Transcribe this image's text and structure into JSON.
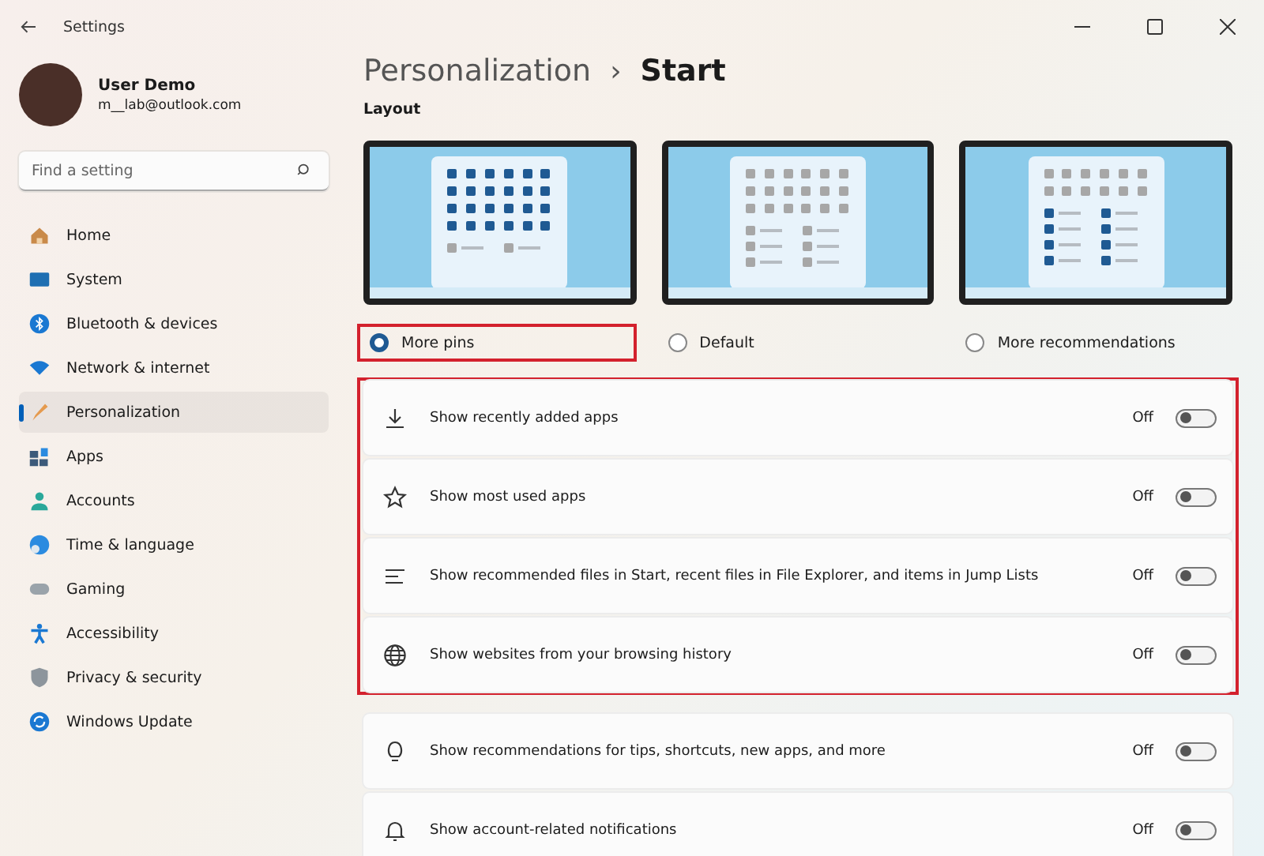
{
  "window": {
    "title": "Settings"
  },
  "account": {
    "name": "User Demo",
    "email": "m__lab@outlook.com"
  },
  "search": {
    "placeholder": "Find a setting"
  },
  "sidebar": {
    "items": [
      {
        "label": "Home",
        "selected": false
      },
      {
        "label": "System",
        "selected": false
      },
      {
        "label": "Bluetooth & devices",
        "selected": false
      },
      {
        "label": "Network & internet",
        "selected": false
      },
      {
        "label": "Personalization",
        "selected": true
      },
      {
        "label": "Apps",
        "selected": false
      },
      {
        "label": "Accounts",
        "selected": false
      },
      {
        "label": "Time & language",
        "selected": false
      },
      {
        "label": "Gaming",
        "selected": false
      },
      {
        "label": "Accessibility",
        "selected": false
      },
      {
        "label": "Privacy & security",
        "selected": false
      },
      {
        "label": "Windows Update",
        "selected": false
      }
    ]
  },
  "breadcrumb": {
    "parent": "Personalization",
    "separator": "›",
    "current": "Start"
  },
  "layout": {
    "heading": "Layout",
    "options": [
      {
        "label": "More pins",
        "kind": "pins",
        "selected": true,
        "highlighted": true
      },
      {
        "label": "Default",
        "kind": "default",
        "selected": false,
        "highlighted": false
      },
      {
        "label": "More recommendations",
        "kind": "recommendations",
        "selected": false,
        "highlighted": false
      }
    ]
  },
  "settings": [
    {
      "label": "Show recently added apps",
      "state": "Off",
      "on": false,
      "highlighted": true
    },
    {
      "label": "Show most used apps",
      "state": "Off",
      "on": false,
      "highlighted": true
    },
    {
      "label": "Show recommended files in Start, recent files in File Explorer, and items in Jump Lists",
      "state": "Off",
      "on": false,
      "highlighted": true
    },
    {
      "label": "Show websites from your browsing history",
      "state": "Off",
      "on": false,
      "highlighted": true
    },
    {
      "label": "Show recommendations for tips, shortcuts, new apps, and more",
      "state": "Off",
      "on": false,
      "highlighted": false
    },
    {
      "label": "Show account-related notifications",
      "state": "Off",
      "on": false,
      "highlighted": false
    }
  ]
}
